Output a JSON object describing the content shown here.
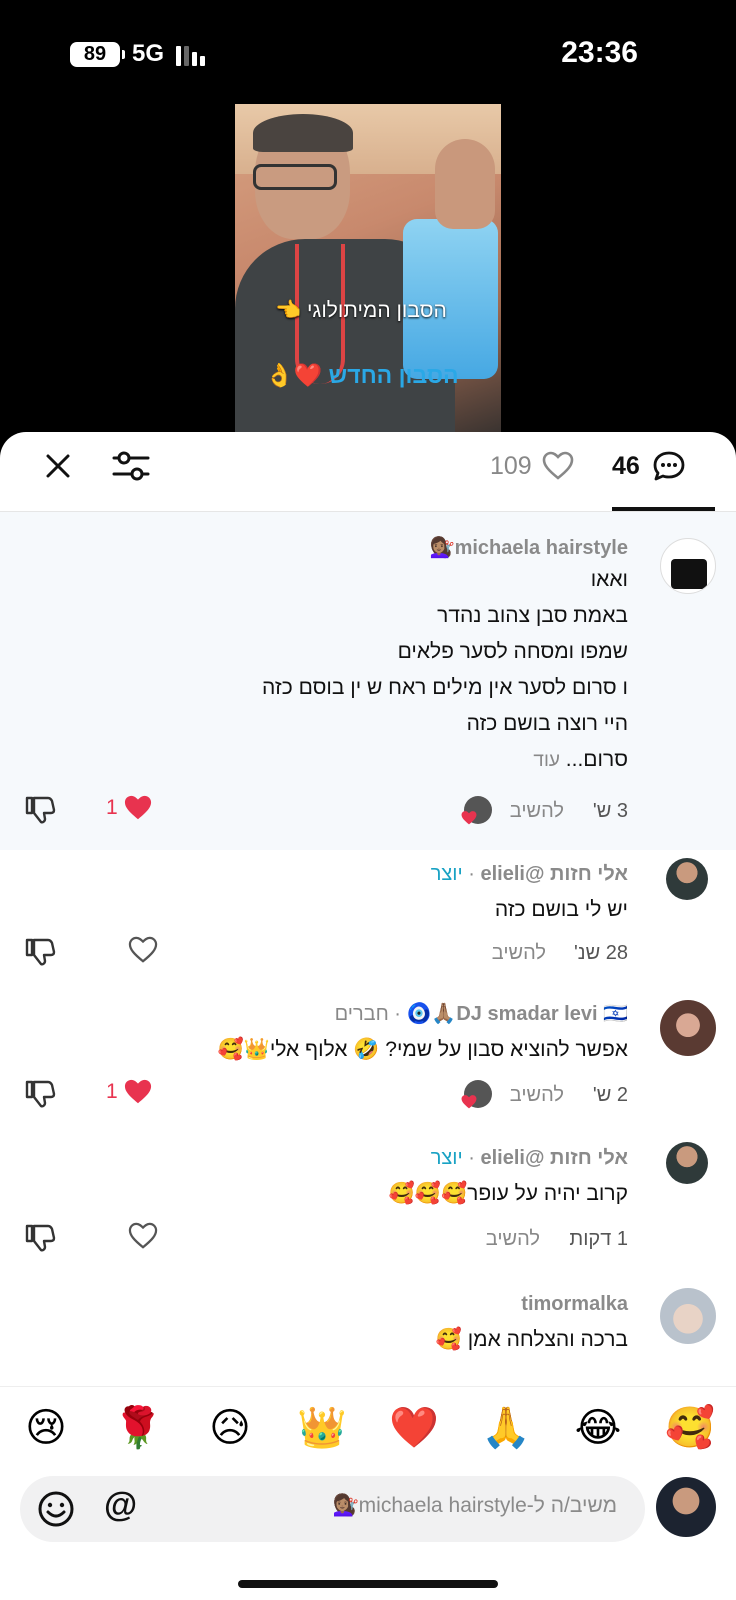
{
  "status_bar": {
    "battery": "89",
    "network": "5G",
    "time": "23:36"
  },
  "video": {
    "caption_line1": "הסבון המיתולוגי 👈",
    "caption_line2": "הסבון החדש ❤️👌"
  },
  "header": {
    "likes_count": "109",
    "comments_count": "46"
  },
  "comments": [
    {
      "username": "michaela hairstyle💇🏽‍♀️",
      "lines": [
        "ואאו",
        "באמת סבן צהוב נהדר",
        "שמפו ומסחה לסער פלאים",
        "ו סרום לסער אין מילים ראח ש ין בוסם כזה",
        "היי רוצה בושם כזה"
      ],
      "last_line": "סרום...",
      "more_label": "עוד",
      "time": "3 ש'",
      "reply_label": "להשיב",
      "like_count": "1"
    },
    {
      "username": "אלי חזות @elieli",
      "creator_label": "יוצר",
      "text": "יש לי בושם כזה",
      "time": "28 שנ'",
      "reply_label": "להשיב"
    },
    {
      "username": "DJ smadar levi 🇮🇱🙏🏽🧿",
      "friends_label": "חברים",
      "text": "אפשר להוציא סבון על שמי? 🤣 אלוף אלי👑🥰",
      "time": "2 ש'",
      "reply_label": "להשיב",
      "like_count": "1"
    },
    {
      "username": "אלי חזות @elieli",
      "creator_label": "יוצר",
      "text": "קרוב יהיה על עופר🥰🥰🥰",
      "time": "1 דקות",
      "reply_label": "להשיב"
    },
    {
      "username": "timormalka",
      "text": "ברכה והצלחה אמן 🥰"
    }
  ],
  "emoji_bar": [
    "🥰",
    "😂",
    "🙏",
    "❤️",
    "👑",
    "😥",
    "🌹",
    "😢"
  ],
  "composer": {
    "placeholder": "משיב/ה ל-michaela hairstyle💇🏽‍♀️",
    "at_label": "@"
  },
  "colors": {
    "like_red": "#e8334f",
    "creator_blue": "#19a2c4",
    "highlight_bg": "#f6f9fc"
  }
}
